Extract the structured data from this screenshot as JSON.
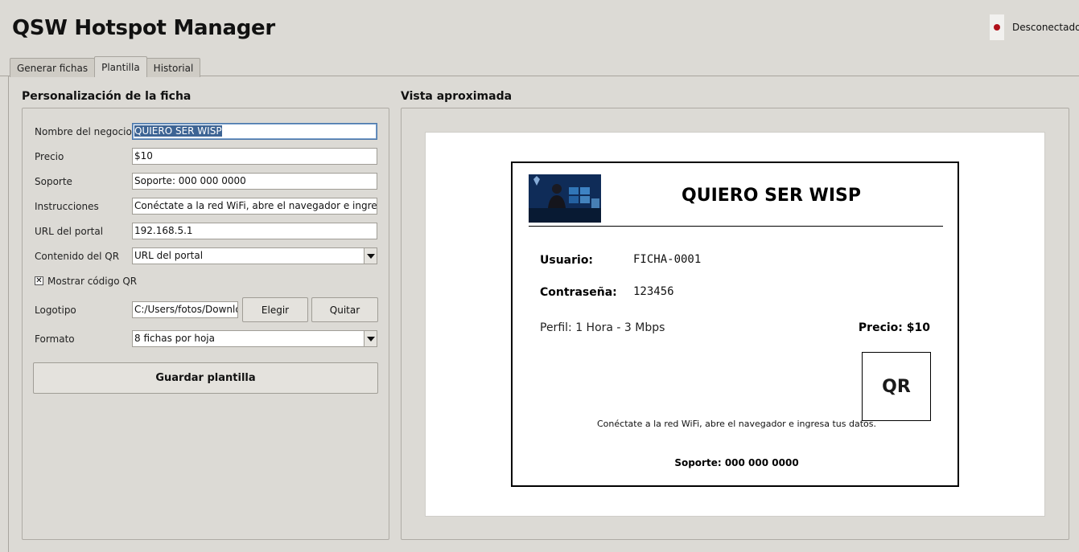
{
  "app": {
    "title": "QSW Hotspot Manager"
  },
  "status": {
    "text": "Desconectado",
    "color": "#b0101a"
  },
  "tabs": [
    {
      "label": "Generar fichas",
      "active": false
    },
    {
      "label": "Plantilla",
      "active": true
    },
    {
      "label": "Historial",
      "active": false
    }
  ],
  "form": {
    "title": "Personalización de la ficha",
    "business_name": {
      "label": "Nombre del negocio",
      "value": "QUIERO SER WISP"
    },
    "price": {
      "label": "Precio",
      "value": "$10"
    },
    "support": {
      "label": "Soporte",
      "value": "Soporte: 000 000 0000"
    },
    "instructions": {
      "label": "Instrucciones",
      "value": "Conéctate a la red WiFi, abre el navegador e ingresa tus d"
    },
    "portal_url": {
      "label": "URL del portal",
      "value": "192.168.5.1"
    },
    "qr_content": {
      "label": "Contenido del QR",
      "value": "URL del portal"
    },
    "show_qr": {
      "label": "Mostrar código QR",
      "checked": true,
      "mark": "✕"
    },
    "logo": {
      "label": "Logotipo",
      "value": "C:/Users/fotos/Downloa",
      "choose_label": "Elegir",
      "remove_label": "Quitar"
    },
    "format": {
      "label": "Formato",
      "value": "8 fichas por hoja"
    },
    "save_label": "Guardar plantilla"
  },
  "preview": {
    "title": "Vista aproximada",
    "ticket": {
      "business_name": "QUIERO SER WISP",
      "user_label": "Usuario:",
      "user_value": "FICHA-0001",
      "password_label": "Contraseña:",
      "password_value": "123456",
      "profile": "Perfil: 1 Hora - 3 Mbps",
      "price": "Precio: $10",
      "qr_placeholder": "QR",
      "instructions": "Conéctate a la red WiFi, abre el navegador e ingresa tus datos.",
      "support": "Soporte: 000 000 0000"
    }
  }
}
